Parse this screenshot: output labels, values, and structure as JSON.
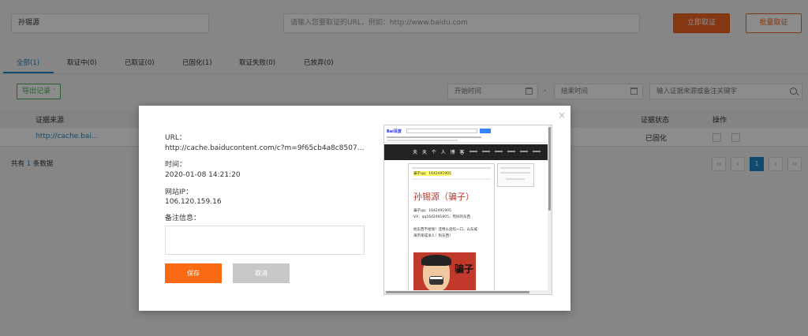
{
  "search": {
    "name_value": "孙锡源",
    "url_placeholder": "请输入您要取证的URL，例如：http://www.baidu.com",
    "instant_button": "立即取证",
    "batch_button": "批量取证"
  },
  "tabs": [
    {
      "label": "全部(1)",
      "active": true
    },
    {
      "label": "取证中(0)",
      "active": false
    },
    {
      "label": "已取证(0)",
      "active": false
    },
    {
      "label": "已固化(1)",
      "active": false
    },
    {
      "label": "取证失败(0)",
      "active": false
    },
    {
      "label": "已放弃(0)",
      "active": false
    }
  ],
  "toolbar": {
    "export_label": "导出记录",
    "start_time_placeholder": "开始时间",
    "end_time_placeholder": "结束时间",
    "dash": "-",
    "keyword_placeholder": "输入证据来源或备注关键字"
  },
  "table": {
    "headers": {
      "source": "证据来源",
      "status": "证据状态",
      "action": "操作"
    },
    "rows": [
      {
        "source": "http://cache.bai...",
        "status": "已固化"
      }
    ]
  },
  "footer": {
    "total_prefix": "共有",
    "total_count": "1",
    "total_suffix": "条数据"
  },
  "pagination": {
    "first": "‹‹",
    "prev": "‹",
    "current": "1",
    "next": "›",
    "last": "››"
  },
  "modal": {
    "close": "×",
    "url_label": "URL：",
    "url_value": "http://cache.baiducontent.com/c?m=9f65cb4a8c8507ed4fece763…",
    "time_label": "时间：",
    "time_value": "2020-01-08 14:21:20",
    "ip_label": "网站IP：",
    "ip_value": "106.120.159.16",
    "note_label": "备注信息：",
    "note_value": "",
    "save_button": "保存",
    "cancel_button": "取消"
  },
  "preview": {
    "logo": "Bai百度",
    "blog_title": "天 天 个 人 博 客",
    "headline": "孙锡源（骗子）",
    "line1": "骗子qq：1642491905",
    "line2": "VX：qq1642491905，死妈的东西",
    "line3": "他东西不给钱！还特么反咬一口，山东威",
    "line4": "海市荣成洋人！狗东西！",
    "image_caption": "骗子"
  },
  "colors": {
    "accent_orange": "#f26522",
    "link_blue": "#1e88c8",
    "export_green": "#4caf50"
  }
}
